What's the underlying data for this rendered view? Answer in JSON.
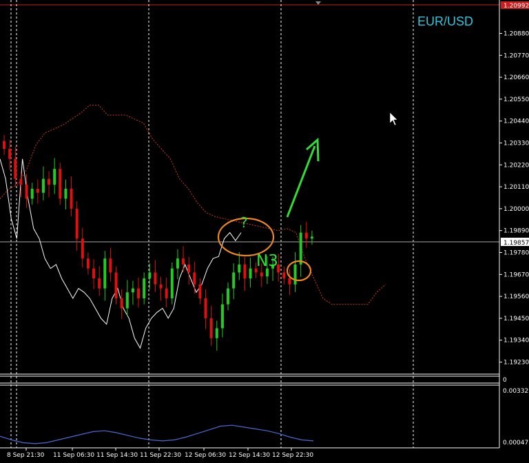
{
  "symbol": "EUR/USD",
  "colors": {
    "background": "#000000",
    "bull": "#22cc22",
    "bear": "#dd1111",
    "grid": "#ffffff",
    "symbol_text": "#33c6e0",
    "annotation_green": "#33dd33",
    "annotation_orange": "#f08820",
    "indicator_line": "#4a6bd8",
    "price_line_white": "#ffffff",
    "envelope": "#d23a2a",
    "current_price_bg": "#ffffff",
    "top_price_bg": "#c81e1e"
  },
  "annotations": {
    "question": "?",
    "n3": "N3"
  },
  "price_axis": {
    "labels": [
      "1.20880",
      "1.20770",
      "1.20660",
      "1.20550",
      "1.20440",
      "1.20330",
      "1.20220",
      "1.20110",
      "1.20000",
      "1.19890",
      "1.19780",
      "1.19670",
      "1.19560",
      "1.19450",
      "1.19340",
      "1.19230"
    ],
    "current_price": "1.19857",
    "top_price": "1.20992"
  },
  "indicator_axis": {
    "labels": [
      "0.00332",
      "0.00047"
    ],
    "zero_label": "0"
  },
  "time_axis": {
    "labels": [
      "8 Sep 21:30",
      "11 Sep 06:30",
      "11 Sep 14:30",
      "11 Sep 22:30",
      "12 Sep 06:30",
      "12 Sep 14:30",
      "12 Sep 22:30"
    ]
  },
  "chart_data": {
    "type": "candlestick",
    "ylim": [
      1.1918,
      1.2102
    ],
    "current_price": 1.19857,
    "white_line": [
      1.2025,
      1.2015,
      1.1995,
      1.1985,
      1.2025,
      1.2005,
      1.199,
      1.1985,
      1.1975,
      1.197,
      1.1972,
      1.1965,
      1.196,
      1.1955,
      1.196,
      1.1958,
      1.1955,
      1.195,
      1.1945,
      1.1942,
      1.1955,
      1.196,
      1.195,
      1.1945,
      1.1935,
      1.193,
      1.194,
      1.1945,
      1.1948,
      1.195,
      1.1945,
      1.195,
      1.1965,
      1.1972,
      1.1965,
      1.1958,
      1.1962,
      1.197,
      1.1975,
      1.1976,
      1.1985,
      1.1988,
      1.1984,
      1.1988
    ],
    "envelope_line": [
      1.2005,
      1.201,
      1.2012,
      1.202,
      1.2032,
      1.2038,
      1.204,
      1.2042,
      1.2045,
      1.2048,
      1.2052,
      1.2052,
      1.2047,
      1.2047,
      1.2047,
      1.2045,
      1.2043,
      1.2035,
      1.203,
      1.2025,
      1.2015,
      1.201,
      1.2003,
      1.1998,
      1.1996,
      1.1995,
      1.1994,
      1.1993,
      1.1992,
      1.1991,
      1.199,
      1.1989,
      1.199,
      1.1988,
      1.1975,
      1.1965,
      1.1955,
      1.1952,
      1.1952,
      1.1952,
      1.1952,
      1.1952,
      1.1958,
      1.1962
    ],
    "closes": [
      1.203,
      1.2025,
      1.2015,
      1.2012,
      1.2005,
      1.201,
      1.2008,
      1.2015,
      1.2012,
      1.202,
      1.2005,
      1.201,
      1.2,
      1.1985,
      1.1975,
      1.197,
      1.1965,
      1.196,
      1.1975,
      1.1968,
      1.1955,
      1.195,
      1.1958,
      1.196,
      1.1955,
      1.1965,
      1.1968,
      1.1962,
      1.196,
      1.1955,
      1.197,
      1.1975,
      1.1972,
      1.1968,
      1.1962,
      1.1955,
      1.1945,
      1.1935,
      1.194,
      1.1952,
      1.196,
      1.1968,
      1.1972,
      1.1965,
      1.197,
      1.1968,
      1.1966,
      1.197,
      1.1972,
      1.1968,
      1.1965,
      1.1962,
      1.1972,
      1.1988,
      1.1985,
      1.1986
    ]
  },
  "indicator_data": {
    "values": [
      0.0008,
      0.0006,
      0.00045,
      0.0004,
      0.00045,
      0.0006,
      0.00075,
      0.0009,
      0.00105,
      0.0011,
      0.001,
      0.00085,
      0.0007,
      0.0006,
      0.00055,
      0.0006,
      0.00075,
      0.00095,
      0.00115,
      0.00135,
      0.0014,
      0.0013,
      0.0012,
      0.0011,
      0.00095,
      0.00075,
      0.0006,
      0.00055
    ]
  }
}
